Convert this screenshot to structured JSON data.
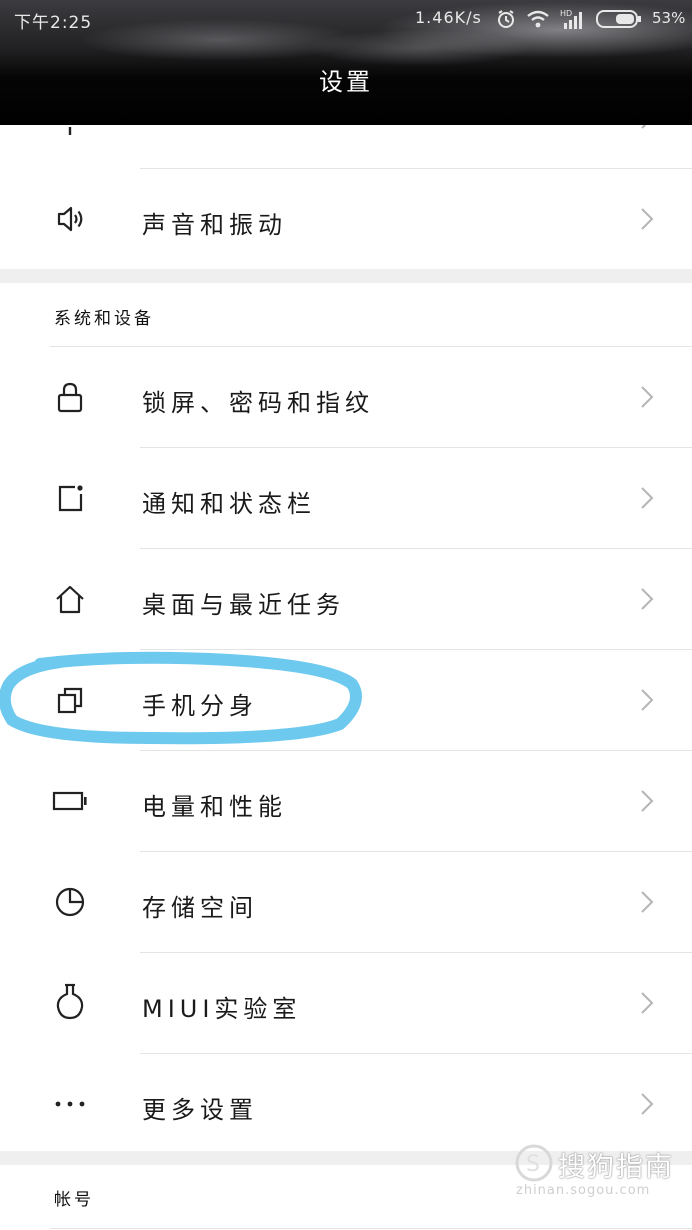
{
  "status_bar": {
    "time": "下午2:25",
    "network_speed": "1.46K/s",
    "battery_percent": "53%",
    "icons": [
      "alarm-icon",
      "wifi-icon",
      "hd-signal-icon",
      "battery-icon"
    ]
  },
  "header": {
    "title": "设置"
  },
  "top_rows": [
    {
      "label": "声音和振动",
      "icon": "speaker-icon"
    }
  ],
  "section_system": {
    "title": "系统和设备",
    "items": [
      {
        "label": "锁屏、密码和指纹",
        "icon": "lock-icon"
      },
      {
        "label": "通知和状态栏",
        "icon": "notification-icon"
      },
      {
        "label": "桌面与最近任务",
        "icon": "home-icon"
      },
      {
        "label": "手机分身",
        "icon": "dual-space-icon"
      },
      {
        "label": "电量和性能",
        "icon": "battery-icon"
      },
      {
        "label": "存储空间",
        "icon": "storage-pie-icon"
      },
      {
        "label": "MIUI实验室",
        "icon": "flask-icon"
      },
      {
        "label": "更多设置",
        "icon": "more-dots-icon"
      }
    ]
  },
  "section_account": {
    "title": "帐号"
  },
  "annotation": {
    "highlight_color": "#6ec9ef"
  },
  "watermark": {
    "text": "搜狗指南",
    "sub": "zhinan.sogou.com"
  }
}
